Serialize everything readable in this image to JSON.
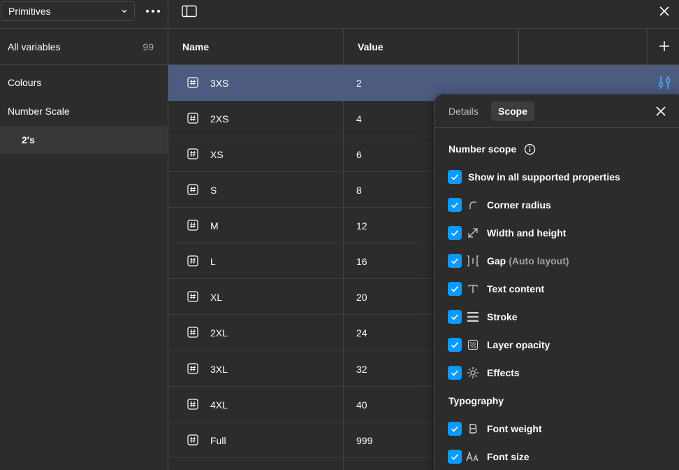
{
  "sidebar": {
    "collection": "Primitives",
    "all_variables_label": "All variables",
    "all_variables_count": "99",
    "groups": [
      {
        "label": "Colours"
      },
      {
        "label": "Number Scale"
      },
      {
        "label": "2's"
      }
    ]
  },
  "table": {
    "headers": {
      "name": "Name",
      "value": "Value"
    },
    "rows": [
      {
        "name": "3XS",
        "value": "2"
      },
      {
        "name": "2XS",
        "value": "4"
      },
      {
        "name": "XS",
        "value": "6"
      },
      {
        "name": "S",
        "value": "8"
      },
      {
        "name": "M",
        "value": "12"
      },
      {
        "name": "L",
        "value": "16"
      },
      {
        "name": "XL",
        "value": "20"
      },
      {
        "name": "2XL",
        "value": "24"
      },
      {
        "name": "3XL",
        "value": "32"
      },
      {
        "name": "4XL",
        "value": "40"
      },
      {
        "name": "Full",
        "value": "999"
      }
    ]
  },
  "popover": {
    "tabs": {
      "details": "Details",
      "scope": "Scope"
    },
    "number_scope_title": "Number scope",
    "all_supported": "Show in all supported properties",
    "options": [
      {
        "label": "Corner radius",
        "icon": "corner-radius-icon"
      },
      {
        "label": "Width and height",
        "icon": "resize-icon"
      },
      {
        "label": "Gap",
        "sub": "(Auto layout)",
        "icon": "gap-icon"
      },
      {
        "label": "Text content",
        "icon": "text-icon"
      },
      {
        "label": "Stroke",
        "icon": "stroke-icon"
      },
      {
        "label": "Layer opacity",
        "icon": "opacity-icon"
      },
      {
        "label": "Effects",
        "icon": "effects-icon"
      }
    ],
    "typography_title": "Typography",
    "typography_options": [
      {
        "label": "Font weight",
        "icon": "font-weight-icon"
      },
      {
        "label": "Font size",
        "icon": "font-size-icon"
      }
    ]
  },
  "colors": {
    "accent": "#0d99ff",
    "selected_row": "#4d5b80",
    "background": "#2c2c2c"
  }
}
